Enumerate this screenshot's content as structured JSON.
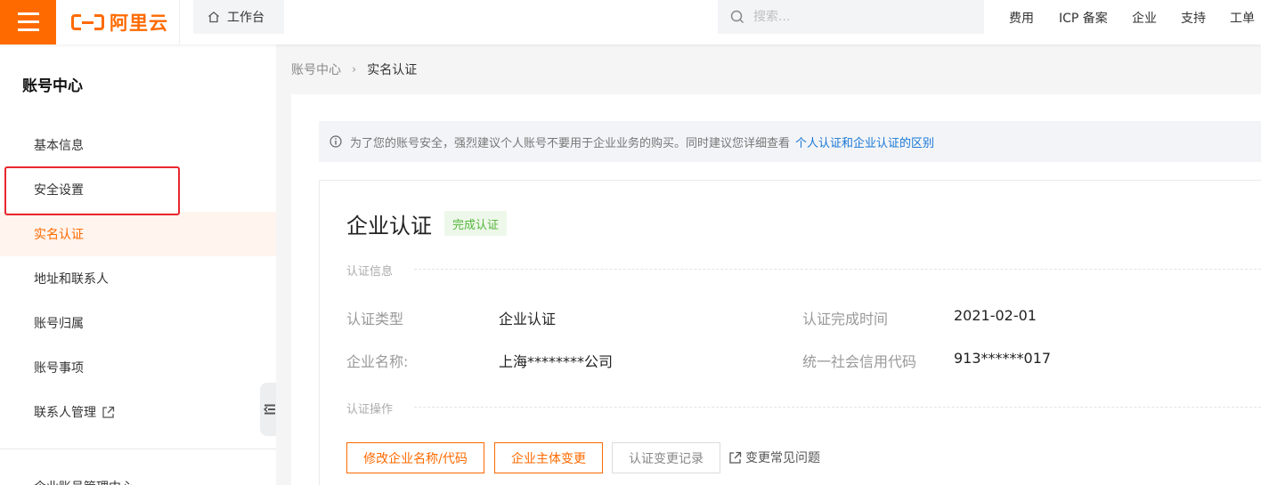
{
  "topbar": {
    "logo_text": "阿里云",
    "workbench_label": "工作台",
    "search_placeholder": "搜索...",
    "nav": [
      "费用",
      "ICP 备案",
      "企业",
      "支持",
      "工单"
    ]
  },
  "sidebar": {
    "title": "账号中心",
    "items": [
      {
        "label": "基本信息"
      },
      {
        "label": "安全设置"
      },
      {
        "label": "实名认证",
        "active": true
      },
      {
        "label": "地址和联系人"
      },
      {
        "label": "账号归属"
      },
      {
        "label": "账号事项"
      },
      {
        "label": "联系人管理",
        "external": true
      }
    ],
    "partial_item": "企业账号管理中心"
  },
  "breadcrumb": {
    "parent": "账号中心",
    "current": "实名认证"
  },
  "notice": {
    "text": "为了您的账号安全，强烈建议个人账号不要用于企业业务的购买。同时建议您详细查看",
    "link": "个人认证和企业认证的区别"
  },
  "cert": {
    "title": "企业认证",
    "status": "完成认证",
    "info_section": "认证信息",
    "fields": {
      "type_label": "认证类型",
      "type_value": "企业认证",
      "time_label": "认证完成时间",
      "time_value": "2021-02-01",
      "name_label": "企业名称:",
      "name_value": "上海********公司",
      "code_label": "统一社会信用代码",
      "code_value": "913******017"
    },
    "ops_section": "认证操作",
    "buttons": {
      "modify": "修改企业名称/代码",
      "change": "企业主体变更",
      "records": "认证变更记录"
    },
    "faq_link": "变更常见问题"
  },
  "colors": {
    "brand": "#ff6a00",
    "highlight": "#e8272f",
    "link": "#1777d6",
    "success": "#52b53a"
  }
}
